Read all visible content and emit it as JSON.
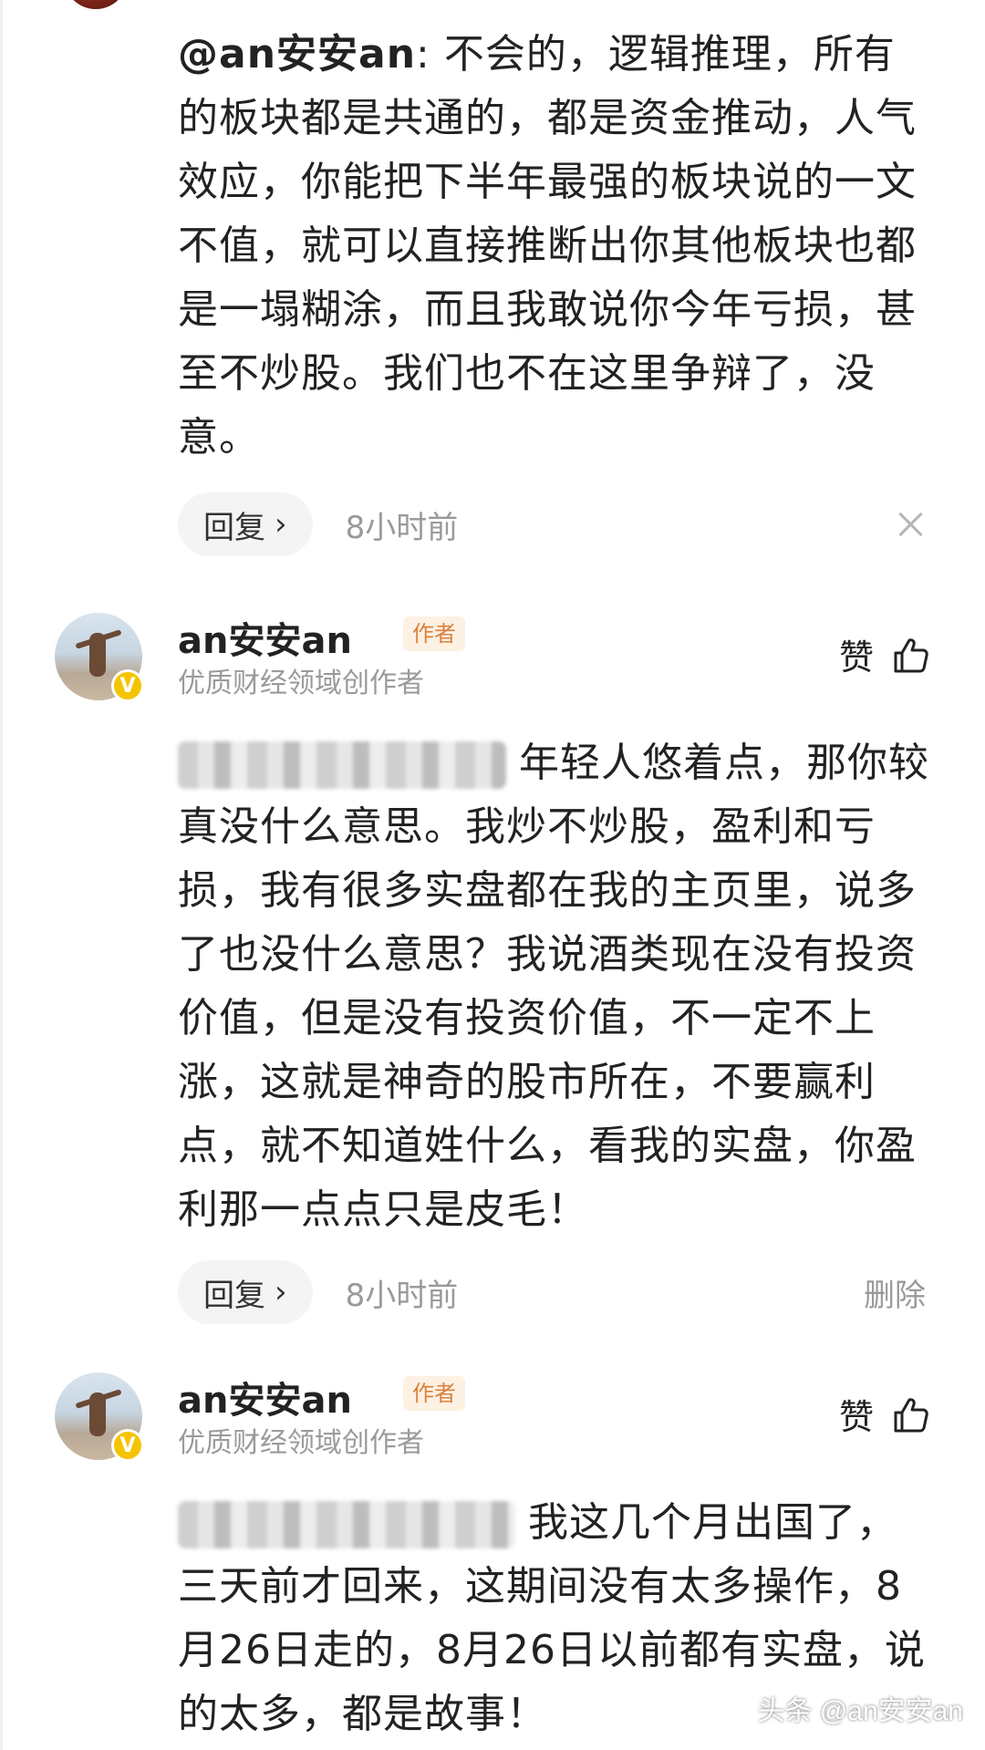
{
  "comments": [
    {
      "mention": "@an安安an",
      "text": ": 不会的，逻辑推理，所有的板块都是共通的，都是资金推动，人气效应，你能把下半年最强的板块说的一文不值，就可以直接推断出你其他板块也都是一塌糊涂，而且我敢说你今年亏损，甚至不炒股。我们也不在这里争辩了，没意。",
      "reply_label": "回复",
      "time": "8小时前"
    },
    {
      "username": "an安安an",
      "badge": "作者",
      "user_desc": "优质财经领域创作者",
      "like_label": "赞",
      "text": "年轻人悠着点，那你较真没什么意思。我炒不炒股，盈利和亏损，我有很多实盘都在我的主页里，说多了也没什么意思？我说酒类现在没有投资价值，但是没有投资价值，不一定不上涨，这就是神奇的股市所在，不要赢利点，就不知道姓什么，看我的实盘，你盈利那一点点只是皮毛！",
      "reply_label": "回复",
      "time": "8小时前",
      "delete_label": "删除"
    },
    {
      "username": "an安安an",
      "badge": "作者",
      "user_desc": "优质财经领域创作者",
      "like_label": "赞",
      "text": "我这几个月出国了，三天前才回来，这期间没有太多操作，8月26日走的，8月26日以前都有实盘，说的太多，都是故事！"
    }
  ],
  "watermark": "头条 @an安安an",
  "verified_mark": "V"
}
